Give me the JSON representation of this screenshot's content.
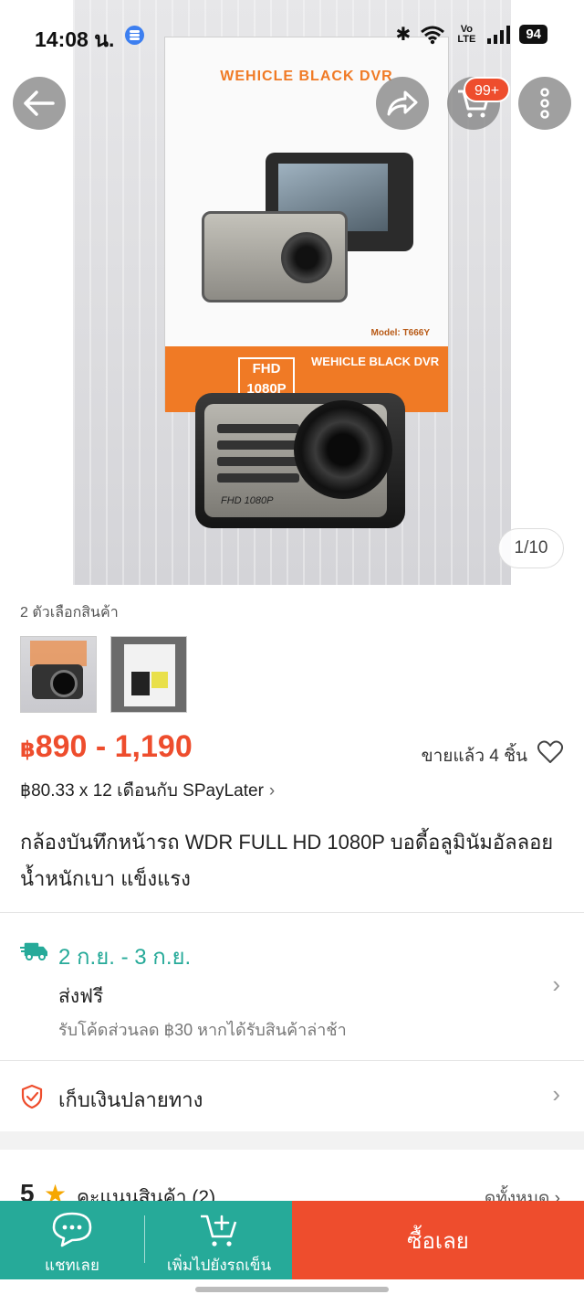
{
  "status_bar": {
    "time": "14:08 น.",
    "network": "Vo LTE",
    "battery": "94"
  },
  "hero": {
    "box_title": "WEHICLE BLACK DVR",
    "box_model": "Model: T666Y",
    "box_fhd": "FHD 1080P",
    "box_brand": "WEHICLE BLACK DVR",
    "camera_label": "FHD 1080P",
    "image_counter": "1/10"
  },
  "top_actions": {
    "cart_badge": "99+"
  },
  "product": {
    "variant_label": "2 ตัวเลือกสินค้า",
    "price_currency": "฿",
    "price_range": "890 - 1,190",
    "sold": "ขายแล้ว 4 ชิ้น",
    "installment": "฿80.33 x 12 เดือนกับ SPayLater",
    "title": "กล้องบันทึกหน้ารถ WDR FULL HD 1080P บอดี้อลูมินัมอัลลอยน้ำหนักเบา แข็งแรง"
  },
  "shipping": {
    "date": "2 ก.ย. - 3 ก.ย.",
    "free": "ส่งฟรี",
    "note": "รับโค้ดส่วนลด ฿30 หากได้รับสินค้าล่าช้า"
  },
  "cod": {
    "label": "เก็บเงินปลายทาง"
  },
  "rating": {
    "score": "5",
    "label": "คะแนนสินค้า (2)",
    "see_all": "ดูทั้งหมด"
  },
  "bottom_bar": {
    "chat": "แชทเลย",
    "add_to_cart": "เพิ่มไปยังรถเข็น",
    "buy_now": "ซื้อเลย"
  },
  "colors": {
    "accent": "#ee4d2d",
    "teal": "#26aa99",
    "star": "#f6a700"
  }
}
